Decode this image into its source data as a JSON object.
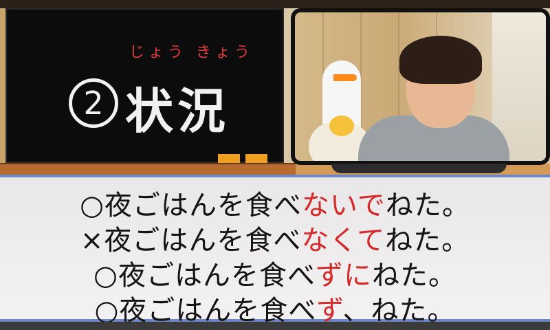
{
  "board": {
    "number": "2",
    "word": "状況",
    "furigana": "じょう きょう"
  },
  "sentences": [
    {
      "mark": "○",
      "pre": "夜ごはんを食べ",
      "highlight": "ないで",
      "post": "ねた。"
    },
    {
      "mark": "×",
      "pre": "夜ごはんを食べ",
      "highlight": "なくて",
      "post": "ねた。"
    },
    {
      "mark": "○",
      "pre": "夜ごはんを食べ",
      "highlight": "ずに",
      "post": "ねた。"
    },
    {
      "mark": "○",
      "pre": "夜ごはんを食べ",
      "highlight": "ず",
      "post": "、ねた。"
    }
  ],
  "colors": {
    "chalk": "#f1f1f1",
    "furigana": "#e23b3b",
    "highlight": "#d52a2a",
    "panel_border": "#6d87c7"
  }
}
